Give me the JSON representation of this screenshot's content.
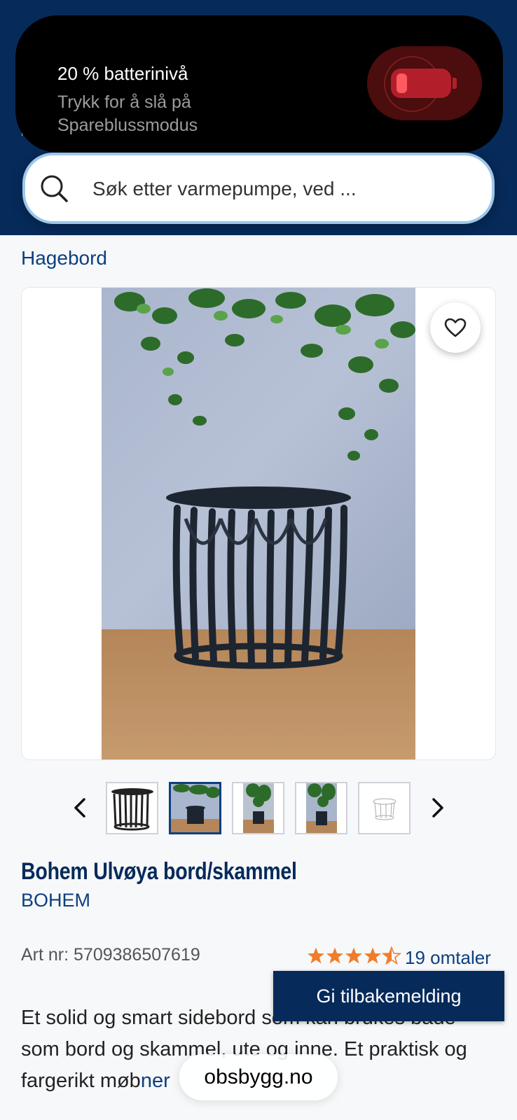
{
  "notification": {
    "title": "20 % batterinivå",
    "subtitle": "Trykk for å slå på Spareblussmodus",
    "battery_percent": 20,
    "icon": "battery-low-icon",
    "accent": "#b21f2b"
  },
  "header": {
    "background": "#062a5a",
    "ghost_text": "M"
  },
  "search": {
    "placeholder": "Søk etter varmepumpe, ved ..."
  },
  "breadcrumb": {
    "current": "Hagebord"
  },
  "gallery": {
    "favorite_icon": "heart-icon",
    "thumbnails": [
      {
        "name": "thumb-1",
        "active": false
      },
      {
        "name": "thumb-2",
        "active": true
      },
      {
        "name": "thumb-3",
        "active": false
      },
      {
        "name": "thumb-4",
        "active": false
      },
      {
        "name": "thumb-5",
        "active": false
      }
    ]
  },
  "product": {
    "title": "Bohem Ulvøya bord/skammel",
    "brand": "BOHEM",
    "art_nr": "Art nr: 5709386507619",
    "rating": 4.5,
    "rating_max": 5,
    "reviews": "19 omtaler",
    "star_color": "#f07d2a",
    "description_before": "Et solid og smart sidebord som kan brukes både som bord og skammel, ute og inne. Et praktisk og fargerikt møb",
    "description_link": "ner"
  },
  "feedback": {
    "label": "Gi tilbakemelding"
  },
  "browser": {
    "url": "obsbygg.no"
  }
}
